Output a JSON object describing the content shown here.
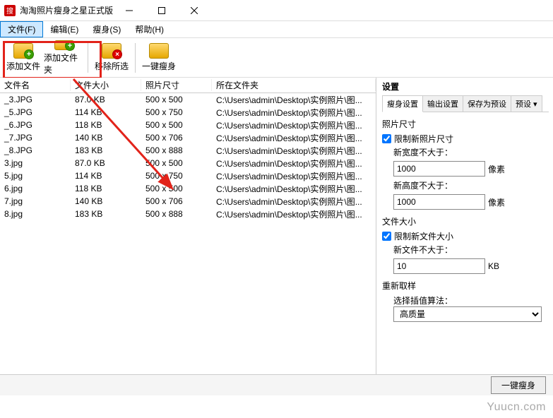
{
  "window": {
    "title": "淘淘照片瘦身之星正式版"
  },
  "menu": {
    "file": "文件(F)",
    "edit": "编辑(E)",
    "slim": "瘦身(S)",
    "help": "帮助(H)"
  },
  "toolbar": {
    "add_file": "添加文件",
    "add_folder": "添加文件夹",
    "remove_selected": "移除所选",
    "one_click": "一键瘦身"
  },
  "list": {
    "headers": {
      "name": "文件名",
      "size": "文件大小",
      "dim": "照片尺寸",
      "folder": "所在文件夹"
    },
    "rows": [
      {
        "name": "_3.JPG",
        "size": "87.0 KB",
        "dim": "500 x 500",
        "folder": "C:\\Users\\admin\\Desktop\\实例照片\\图..."
      },
      {
        "name": "_5.JPG",
        "size": "114 KB",
        "dim": "500 x 750",
        "folder": "C:\\Users\\admin\\Desktop\\实例照片\\图..."
      },
      {
        "name": "_6.JPG",
        "size": "118 KB",
        "dim": "500 x 500",
        "folder": "C:\\Users\\admin\\Desktop\\实例照片\\图..."
      },
      {
        "name": "_7.JPG",
        "size": "140 KB",
        "dim": "500 x 706",
        "folder": "C:\\Users\\admin\\Desktop\\实例照片\\图..."
      },
      {
        "name": "_8.JPG",
        "size": "183 KB",
        "dim": "500 x 888",
        "folder": "C:\\Users\\admin\\Desktop\\实例照片\\图..."
      },
      {
        "name": "3.jpg",
        "size": "87.0 KB",
        "dim": "500 x 500",
        "folder": "C:\\Users\\admin\\Desktop\\实例照片\\图..."
      },
      {
        "name": "5.jpg",
        "size": "114 KB",
        "dim": "500 x 750",
        "folder": "C:\\Users\\admin\\Desktop\\实例照片\\图..."
      },
      {
        "name": "6.jpg",
        "size": "118 KB",
        "dim": "500 x 500",
        "folder": "C:\\Users\\admin\\Desktop\\实例照片\\图..."
      },
      {
        "name": "7.jpg",
        "size": "140 KB",
        "dim": "500 x 706",
        "folder": "C:\\Users\\admin\\Desktop\\实例照片\\图..."
      },
      {
        "name": "8.jpg",
        "size": "183 KB",
        "dim": "500 x 888",
        "folder": "C:\\Users\\admin\\Desktop\\实例照片\\图..."
      }
    ]
  },
  "settings": {
    "title": "设置",
    "tabs": {
      "slim": "瘦身设置",
      "output": "输出设置",
      "save_preset": "保存为预设",
      "preset": "预设 ▾"
    },
    "photo_size": {
      "group": "照片尺寸",
      "limit_size": "限制新照片尺寸",
      "new_width_label": "新宽度不大于：",
      "new_width_value": "1000",
      "new_height_label": "新高度不大于：",
      "new_height_value": "1000",
      "unit": "像素"
    },
    "file_size": {
      "group": "文件大小",
      "limit_file": "限制新文件大小",
      "new_file_label": "新文件不大于：",
      "new_file_value": "10",
      "unit": "KB"
    },
    "resample": {
      "group": "重新取样",
      "algo_label": "选择插值算法：",
      "algo_value": "高质量"
    }
  },
  "bottom": {
    "go": "一键瘦身"
  },
  "watermark": "Yuucn.com"
}
